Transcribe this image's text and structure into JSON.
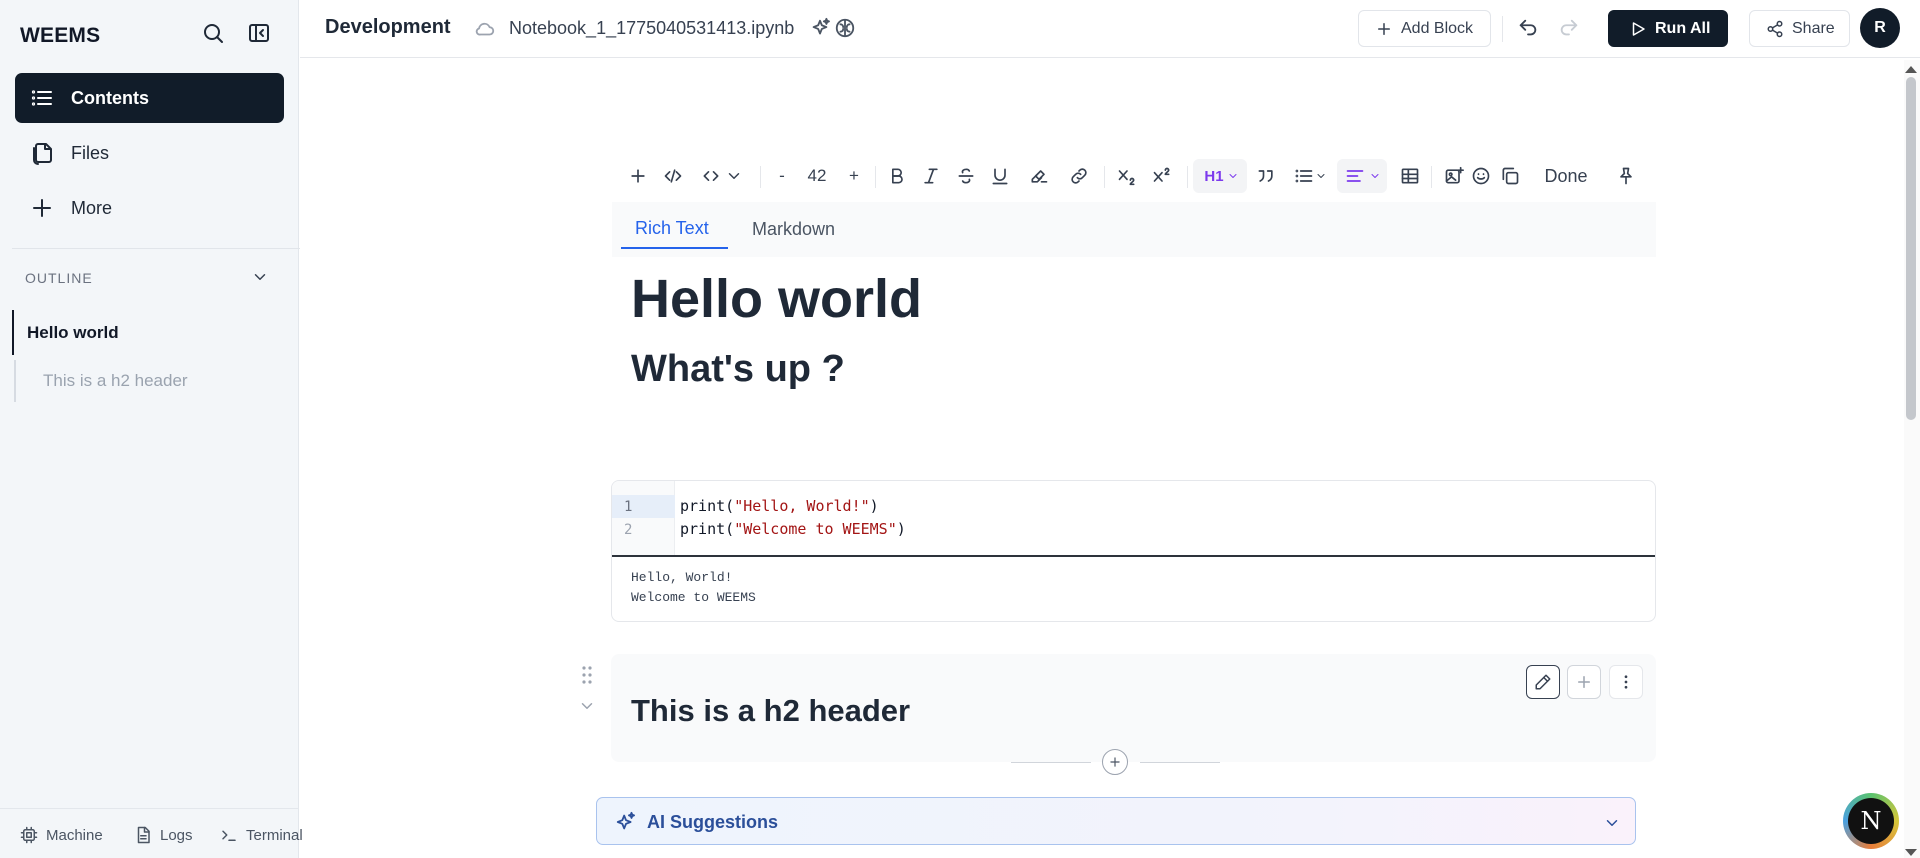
{
  "app": {
    "brand": "WEEMS"
  },
  "sidebar": {
    "nav": [
      {
        "label": "Contents",
        "icon": "list-icon",
        "active": true
      },
      {
        "label": "Files",
        "icon": "files-icon",
        "active": false
      },
      {
        "label": "More",
        "icon": "plus-icon",
        "active": false
      }
    ],
    "outline": {
      "label": "OUTLINE",
      "items": [
        {
          "label": "Hello world",
          "level": 1
        },
        {
          "label": "This is a h2 header",
          "level": 2
        }
      ]
    },
    "bottom": [
      {
        "label": "Machine",
        "icon": "chip-icon"
      },
      {
        "label": "Logs",
        "icon": "document-icon"
      },
      {
        "label": "Terminal",
        "icon": "terminal-icon"
      }
    ]
  },
  "header": {
    "project": "Development",
    "filename": "Notebook_1_1775040531413.ipynb",
    "add_block": "Add Block",
    "run_all": "Run All",
    "share": "Share",
    "avatar": "R"
  },
  "toolbar": {
    "minus": "-",
    "font_size": "42",
    "plus": "+",
    "heading": "H1",
    "done": "Done"
  },
  "editor_tabs": {
    "rich_text": "Rich Text",
    "markdown": "Markdown",
    "active": "Rich Text"
  },
  "cell1": {
    "h1": "Hello world",
    "h2": "What's up ?"
  },
  "code_cell": {
    "lines": [
      {
        "num": "1",
        "fn": "print(",
        "str": "\"Hello, World!\"",
        "end": ")"
      },
      {
        "num": "2",
        "fn": "print(",
        "str": "\"Welcome to WEEMS\"",
        "end": ")"
      }
    ],
    "output": [
      "Hello, World!",
      "Welcome to WEEMS"
    ]
  },
  "cell3": {
    "h2": "This is a h2 header"
  },
  "ai": {
    "label": "AI Suggestions"
  },
  "fab": {
    "label": "N"
  },
  "colors": {
    "accent_dark": "#111c29",
    "tab_active": "#2563eb",
    "string": "#a31515",
    "ai_text": "#2b4f9a"
  }
}
